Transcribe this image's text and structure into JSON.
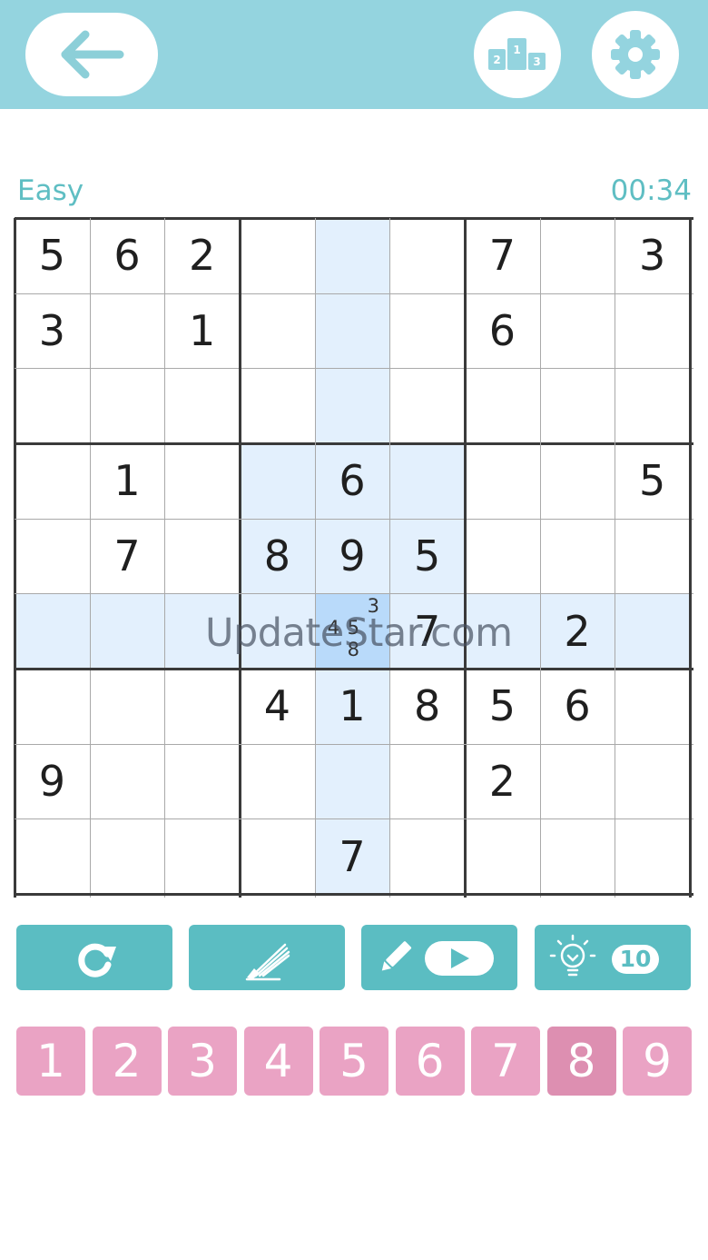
{
  "header": {
    "back_icon": "arrow-left-icon",
    "leaderboard_icon": "podium-icon",
    "leaderboard_places": [
      "2",
      "1",
      "3"
    ],
    "settings_icon": "gear-icon"
  },
  "status": {
    "difficulty": "Easy",
    "timer": "00:34"
  },
  "board": {
    "rows": [
      [
        "5",
        "6",
        "2",
        "",
        "",
        "",
        "7",
        "",
        "3"
      ],
      [
        "3",
        "",
        "1",
        "",
        "",
        "",
        "6",
        "",
        ""
      ],
      [
        "",
        "",
        "",
        "",
        "",
        "",
        "",
        "",
        ""
      ],
      [
        "",
        "1",
        "",
        "",
        "6",
        "",
        "",
        "",
        "5"
      ],
      [
        "",
        "7",
        "",
        "8",
        "9",
        "5",
        "",
        "",
        ""
      ],
      [
        "",
        "",
        "",
        "",
        "",
        "7",
        "",
        "2",
        ""
      ],
      [
        "",
        "",
        "",
        "4",
        "1",
        "8",
        "5",
        "6",
        ""
      ],
      [
        "9",
        "",
        "",
        "",
        "",
        "",
        "2",
        "",
        ""
      ],
      [
        "",
        "",
        "",
        "",
        "7",
        "",
        "",
        "",
        ""
      ]
    ],
    "selected_cell": {
      "row": 5,
      "col": 4
    },
    "selected_cell_notes": [
      "3",
      "4",
      "5",
      "8"
    ],
    "highlight_color": "#e3f0fd",
    "selected_color": "#b9dafa"
  },
  "watermark": "UpdateStar.com",
  "actions": {
    "undo_icon": "undo-icon",
    "erase_icon": "eraser-icon",
    "notes_video_icon": "pencil-video-icon",
    "hint_icon": "lightbulb-icon",
    "hint_count": "10"
  },
  "numpad": {
    "keys": [
      "1",
      "2",
      "3",
      "4",
      "5",
      "6",
      "7",
      "8",
      "9"
    ],
    "selected": "8",
    "key_color": "#eaa3c4",
    "selected_color": "#dd8fb1"
  },
  "colors": {
    "header_bg": "#94d4df",
    "accent": "#5bbdc2",
    "status_text": "#5fbec3"
  }
}
